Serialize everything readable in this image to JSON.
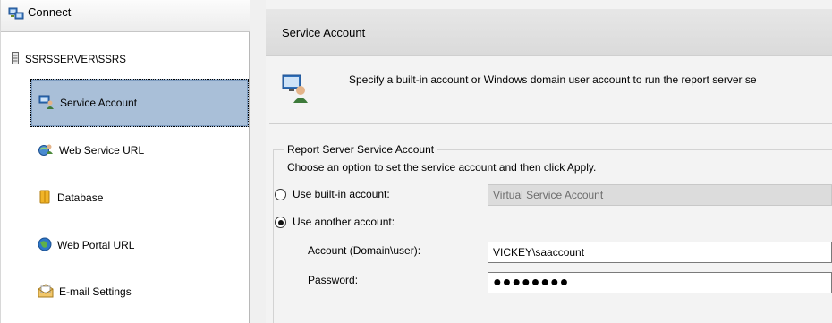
{
  "sidebar": {
    "connect_label": "Connect",
    "server_label": "SSRSSERVER\\SSRS",
    "items": [
      {
        "label": "Service Account",
        "icon": "service-account-icon",
        "selected": true
      },
      {
        "label": "Web Service URL",
        "icon": "web-service-url-icon"
      },
      {
        "label": "Database",
        "icon": "database-icon"
      },
      {
        "label": "Web Portal URL",
        "icon": "globe-icon"
      },
      {
        "label": "E-mail Settings",
        "icon": "email-icon"
      }
    ]
  },
  "main": {
    "header": "Service Account",
    "description": "Specify a built-in account or Windows domain user account to run the report server se",
    "group_title": "Report Server Service Account",
    "group_desc": "Choose an option to set the service account and then click Apply.",
    "builtin_label": "Use built-in account:",
    "builtin_value": "Virtual Service Account",
    "another_label": "Use another account:",
    "account_label": "Account (Domain\\user):",
    "account_value": "VICKEY\\saaccount",
    "password_label": "Password:",
    "password_value": "●●●●●●●●"
  }
}
